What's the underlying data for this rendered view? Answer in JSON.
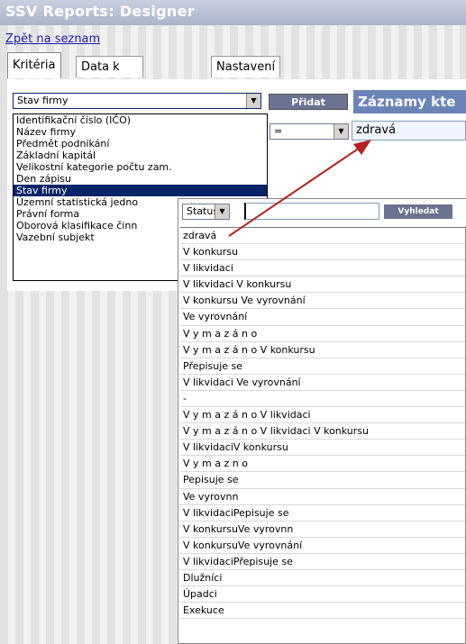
{
  "window": {
    "title": "SSV Reports: Designer"
  },
  "nav": {
    "back_link": "Zpět na seznam"
  },
  "tabs": [
    {
      "label": "Kritéria",
      "active": true
    },
    {
      "label": "Data k zobrazení",
      "active": false
    },
    {
      "label": "Nastavení",
      "active": false
    }
  ],
  "criteria": {
    "field_select": "Stav firmy",
    "add_button": "Přidat",
    "records_header": "Záznamy kte",
    "operator": "=",
    "value": "zdravá",
    "field_options": [
      "Identifikační číslo (IČO)",
      "Název firmy",
      "Předmět podnikání",
      "Základní kapitál",
      "Velikostní kategorie počtu zam.",
      "Den zápisu",
      "Stav firmy",
      "Územní statistická jedno",
      "Právní forma",
      "Oborová klasifikace činn",
      "Vazební subjekt"
    ],
    "selected_index": 6
  },
  "popup": {
    "filter_select": "Status",
    "search_value": "",
    "search_button": "Vyhledat",
    "results": [
      "zdravá",
      "V konkursu",
      "V likvidaci",
      "V likvidaci V konkursu",
      "V konkursu Ve vyrovnání",
      "Ve vyrovnání",
      "V y m a z á n o",
      "V y m a z á n o V konkursu",
      "Přepisuje se",
      "V likvidaci Ve vyrovnání",
      "-",
      "V y m a z á n o V likvidaci",
      "V y m a z á n o V likvidaci V konkursu",
      "V likvidaciV konkursu",
      "V y m a z n o",
      "Pepisuje se",
      "Ve vyrovnn",
      "V likvidaciPepisuje se",
      "V konkursuVe vyrovnn",
      "V konkursuVe vyrovnání",
      "V likvidaciPřepisuje se",
      "Dlužníci",
      "Úpadci",
      "Exekuce"
    ]
  },
  "colors": {
    "accent": "#6c83b8",
    "arrow": "#b22222",
    "selection": "#0a246a",
    "button": "#6c7390"
  }
}
